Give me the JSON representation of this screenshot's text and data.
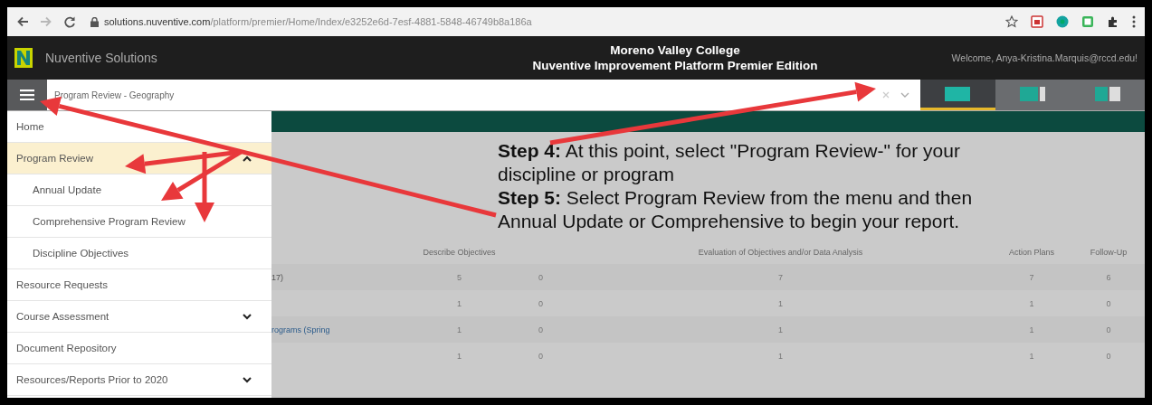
{
  "browser": {
    "back_disabled": false,
    "forward_disabled": true,
    "url_host": "solutions.nuventive.com",
    "url_path": "/platform/premier/Home/Index/e3252e6d-7esf-4881-5848-46749b8a186a"
  },
  "header": {
    "brand": "Nuventive Solutions",
    "college": "Moreno Valley College",
    "platform": "Nuventive Improvement Platform Premier Edition",
    "welcome": "Welcome, Anya-Kristina.Marquis@rccd.edu!"
  },
  "toolbar": {
    "program_select": "Program Review - Geography",
    "view_tabs": [
      {
        "selected": true
      },
      {
        "selected": false
      },
      {
        "selected": false
      }
    ]
  },
  "sidebar": {
    "items": [
      {
        "label": "Home",
        "selected": false
      },
      {
        "label": "Program Review",
        "selected": true,
        "expanded": true,
        "children": [
          {
            "label": "Annual Update",
            "selected": false
          },
          {
            "label": "Comprehensive Program Review",
            "selected": false
          },
          {
            "label": "Discipline Objectives",
            "selected": false
          }
        ]
      },
      {
        "label": "Resource Requests",
        "selected": false
      },
      {
        "label": "Course Assessment",
        "selected": false,
        "expanded": false
      },
      {
        "label": "Document Repository",
        "selected": false
      },
      {
        "label": "Resources/Reports Prior to 2020",
        "selected": false,
        "expanded": false
      }
    ]
  },
  "callout": [
    "**Step 4:** At this point, select \"Program Review-\" for your discipline or program",
    "**Step 5:** Select Program Review from the menu and then Annual Update or Comprehensive to begin your report."
  ],
  "table": {
    "columns": [
      {
        "label": "Describe Objectives"
      },
      {},
      {
        "label": "Evaluation of Objectives and/or Data Analysis"
      },
      {
        "label": "Action Plans"
      },
      {
        "label": "Follow-Up"
      }
    ],
    "rows": [
      {
        "label": "17)",
        "link": false,
        "cells": [
          "5",
          "0",
          "7",
          "7",
          "6"
        ]
      },
      {
        "cells": [
          "1",
          "0",
          "1",
          "1",
          "0"
        ]
      },
      {
        "label": "rograms (Spring",
        "link": true,
        "cells": [
          "1",
          "0",
          "1",
          "1",
          "0"
        ]
      },
      {
        "cells": [
          "1",
          "0",
          "1",
          "1",
          "0"
        ]
      }
    ]
  }
}
